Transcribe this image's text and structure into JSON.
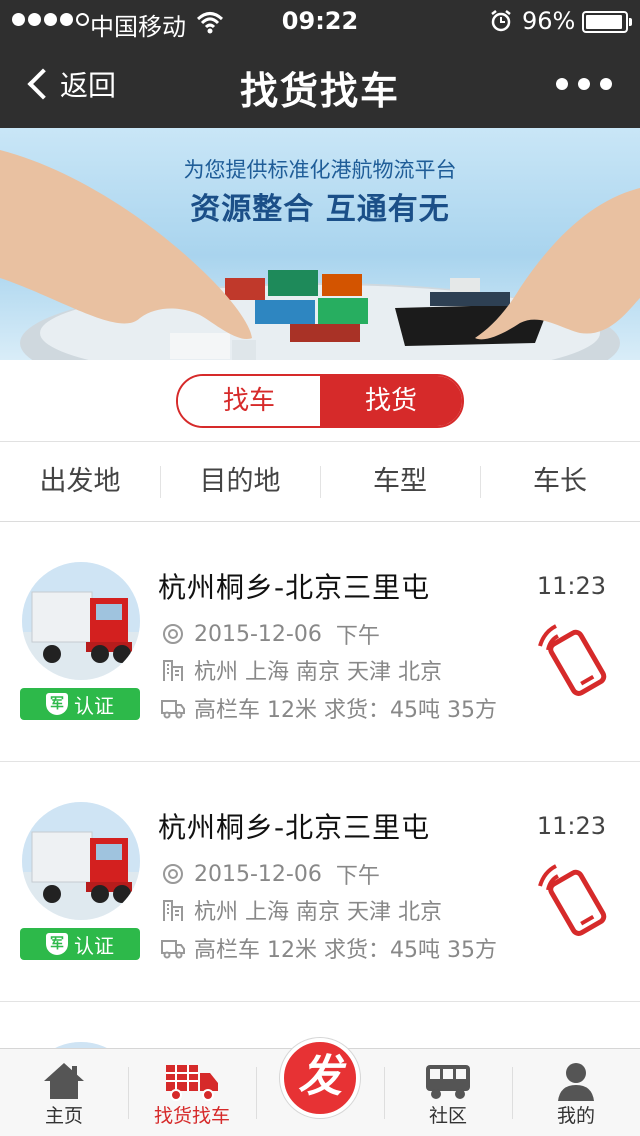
{
  "status_bar": {
    "carrier": "中国移动",
    "time": "09:22",
    "battery": "96%",
    "battery_level": 0.96
  },
  "header": {
    "back_label": "返回",
    "title": "找货找车"
  },
  "banner": {
    "line1": "为您提供标准化港航物流平台",
    "line2": "资源整合 互通有无"
  },
  "segment": {
    "left": "找车",
    "right": "找货",
    "selected": "找货"
  },
  "filters": [
    "出发地",
    "目的地",
    "车型",
    "车长"
  ],
  "listings": [
    {
      "route": "杭州桐乡-北京三里屯",
      "time": "11:23",
      "date": "2015-12-06",
      "period": "下午",
      "cities": "杭州  上海  南京  天津  北京",
      "truck": "高栏车  12米  求货：45吨  35方",
      "badge": "认证",
      "badge_icon": "军"
    },
    {
      "route": "杭州桐乡-北京三里屯",
      "time": "11:23",
      "date": "2015-12-06",
      "period": "下午",
      "cities": "杭州  上海  南京  天津  北京",
      "truck": "高栏车  12米  求货：45吨  35方",
      "badge": "认证",
      "badge_icon": "军"
    }
  ],
  "tabbar": {
    "home": "主页",
    "find": "找货找车",
    "publish": "发",
    "community": "社区",
    "mine": "我的"
  },
  "colors": {
    "accent": "#d62a2a",
    "badge_green": "#2db94a",
    "header_dark": "#2f2f2f"
  }
}
